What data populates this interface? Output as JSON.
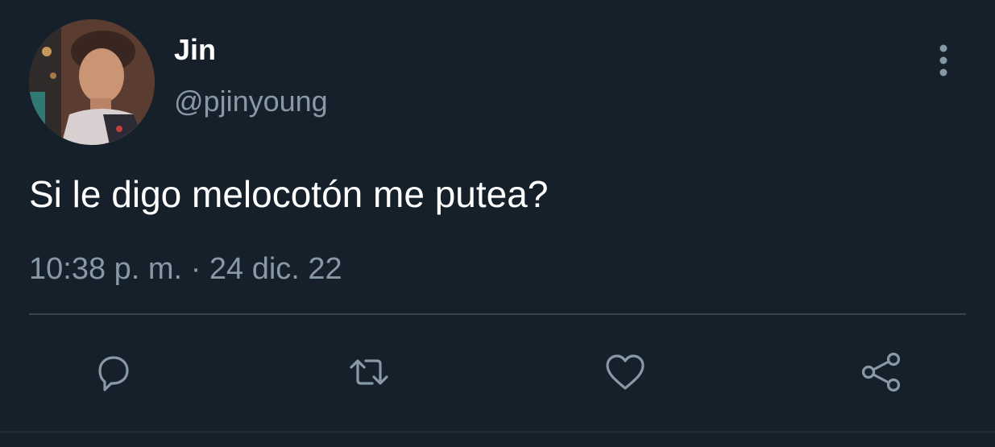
{
  "tweet": {
    "author": {
      "display_name": "Jin",
      "handle": "@pjinyoung",
      "avatar_icon": "profile-photo"
    },
    "text": "Si le digo melocotón me putea?",
    "meta": {
      "time": "10:38 p. m.",
      "separator": "·",
      "date": "24 dic. 22"
    },
    "actions": [
      {
        "name": "reply",
        "icon": "reply-icon"
      },
      {
        "name": "retweet",
        "icon": "retweet-icon"
      },
      {
        "name": "like",
        "icon": "heart-icon"
      },
      {
        "name": "share",
        "icon": "share-icon"
      }
    ],
    "more_icon": "more-vertical-icon"
  },
  "colors": {
    "background": "#15202b",
    "primary_text": "#ffffff",
    "secondary_text": "#8899a6",
    "divider": "#38444d"
  }
}
